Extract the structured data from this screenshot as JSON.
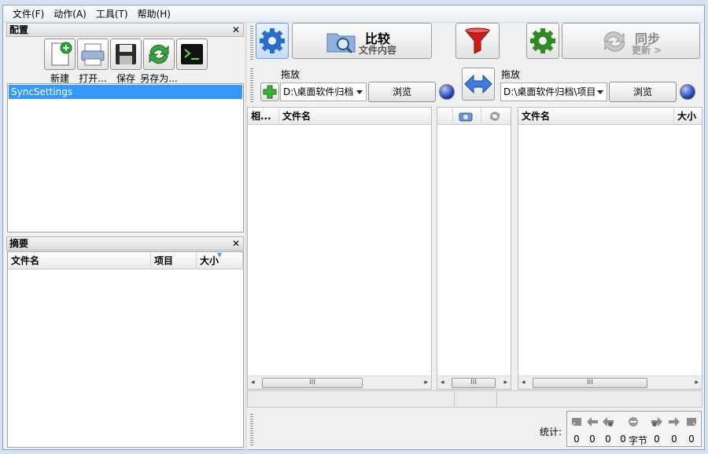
{
  "menu": [
    "文件(F)",
    "动作(A)",
    "工具(T)",
    "帮助(H)"
  ],
  "config_panel": {
    "title": "配置",
    "close": "✕",
    "buttons": [
      {
        "label": "新建",
        "icon": "new-file-icon"
      },
      {
        "label": "打开...",
        "icon": "open-printer-icon"
      },
      {
        "label": "保存",
        "icon": "save-disk-icon"
      },
      {
        "label": "另存为...",
        "icon": "save-as-sync-icon"
      }
    ],
    "items": [
      "SyncSettings"
    ]
  },
  "summary_panel": {
    "title": "摘要",
    "close": "✕",
    "columns": [
      "文件名",
      "项目",
      "大小"
    ]
  },
  "toolbar": {
    "compare_title": "比较",
    "compare_sub": "文件内容",
    "sync_title": "同步",
    "sync_sub": "更新 >"
  },
  "left_folder": {
    "drop_label": "拖放",
    "path": "D:\\桌面软件归档",
    "browse": "浏览"
  },
  "right_folder": {
    "drop_label": "拖放",
    "path": "D:\\桌面软件归档\\项目",
    "browse": "浏览"
  },
  "left_grid": {
    "columns": [
      "相...",
      "文件名"
    ],
    "scroll_thumb": "III"
  },
  "middle_grid": {
    "scroll_thumb": "III"
  },
  "right_grid": {
    "columns": [
      "文件名",
      "大小"
    ],
    "scroll_thumb": "III"
  },
  "stats": {
    "label": "统计:",
    "values": [
      "0",
      "0",
      "0",
      "0",
      "0",
      "0",
      "0"
    ],
    "bytes_unit": "字节"
  },
  "colors": {
    "selection": "#3399ff",
    "filter_red": "#d11b1b",
    "gear_blue": "#2a6cc9",
    "gear_green": "#2e8b22"
  }
}
